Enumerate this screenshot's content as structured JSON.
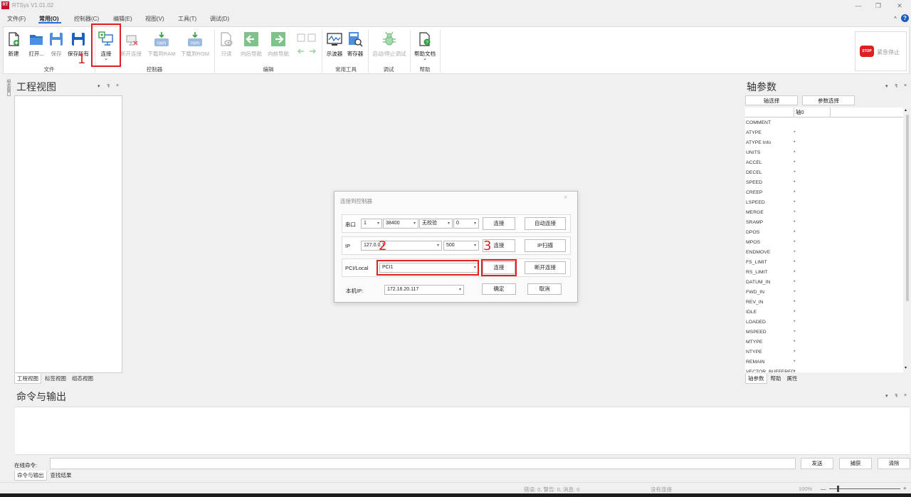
{
  "window": {
    "title": "RTSys V1.01.02",
    "logo": "RT",
    "minimize": "—",
    "restore": "❐",
    "close": "✕"
  },
  "menu": [
    "文件(F)",
    "常用(O)",
    "控制器(C)",
    "编辑(E)",
    "视图(V)",
    "工具(T)",
    "调试(D)"
  ],
  "menu_active_index": 1,
  "menu_collapse": "^",
  "menu_help": "?",
  "ribbon": {
    "buttons": [
      {
        "label": "新建",
        "icon": "new-file-icon"
      },
      {
        "label": "打开...",
        "icon": "open-folder-icon"
      },
      {
        "label": "保存",
        "icon": "save-icon"
      },
      {
        "label": "保存所有",
        "icon": "save-all-icon"
      },
      {
        "label": "连接",
        "icon": "connect-icon"
      },
      {
        "label": "断开连接",
        "icon": "disconnect-icon"
      },
      {
        "label": "下载到RAM",
        "icon": "download-ram-icon",
        "icon_text": "ram"
      },
      {
        "label": "下载到ROM",
        "icon": "download-rom-icon",
        "icon_text": "rom"
      },
      {
        "label": "只读",
        "icon": "read-only-icon"
      },
      {
        "label": "向后导航",
        "icon": "navigate-back-icon"
      },
      {
        "label": "向前导航",
        "icon": "navigate-forward-icon"
      },
      {
        "label": "示波器",
        "icon": "oscilloscope-icon"
      },
      {
        "label": "寄存器",
        "icon": "register-icon"
      },
      {
        "label": "启动/停止调试",
        "icon": "debug-bug-icon"
      },
      {
        "label": "帮助文档",
        "icon": "help-document-icon"
      }
    ],
    "groups": [
      "文件",
      "控制器",
      "编辑",
      "常用工具",
      "调试",
      "帮助"
    ],
    "connect_dropdown": "⌄",
    "help_dropdown": "⌄",
    "estop_icon_text": "STOP",
    "estop_label": "紧急停止"
  },
  "annotations": {
    "step1": "1",
    "step2": "2",
    "step3": "3"
  },
  "left_strip": "组态窗口",
  "project_panel": {
    "title": "工程视图",
    "tabs": [
      "工程视图",
      "标签视图",
      "组态视图"
    ]
  },
  "panel_controls": {
    "dropdown": "▾",
    "pin": "ꟻ",
    "close": "×"
  },
  "axis_panel": {
    "title": "轴参数",
    "axis_select": "轴选择",
    "param_select": "参数选择",
    "column": "轴0",
    "rows": [
      {
        "name": "COMMENT",
        "value": ""
      },
      {
        "name": "ATYPE",
        "value": "*"
      },
      {
        "name": "ATYPE Info",
        "value": "*"
      },
      {
        "name": "UNITS",
        "value": "*"
      },
      {
        "name": "ACCEL",
        "value": "*"
      },
      {
        "name": "DECEL",
        "value": "*"
      },
      {
        "name": "SPEED",
        "value": "*"
      },
      {
        "name": "CREEP",
        "value": "*"
      },
      {
        "name": "LSPEED",
        "value": "*"
      },
      {
        "name": "MERGE",
        "value": "*"
      },
      {
        "name": "SRAMP",
        "value": "*"
      },
      {
        "name": "DPOS",
        "value": "*"
      },
      {
        "name": "MPOS",
        "value": "*"
      },
      {
        "name": "ENDMOVE",
        "value": "*"
      },
      {
        "name": "FS_LIMIT",
        "value": "*"
      },
      {
        "name": "RS_LIMIT",
        "value": "*"
      },
      {
        "name": "DATUM_IN",
        "value": "*"
      },
      {
        "name": "FWD_IN",
        "value": "*"
      },
      {
        "name": "REV_IN",
        "value": "*"
      },
      {
        "name": "IDLE",
        "value": "*"
      },
      {
        "name": "LOADED",
        "value": "*"
      },
      {
        "name": "MSPEED",
        "value": "*"
      },
      {
        "name": "MTYPE",
        "value": "*"
      },
      {
        "name": "NTYPE",
        "value": "*"
      },
      {
        "name": "REMAIN",
        "value": "*"
      },
      {
        "name": "VECTOR_BUFFERED",
        "value": "*"
      }
    ],
    "tabs": [
      "轴参数",
      "帮助",
      "属性"
    ],
    "scroll_up": "▴",
    "scroll_down": "▾"
  },
  "dialog": {
    "title": "连接到控制器",
    "close": "×",
    "serial": {
      "label": "串口",
      "port": "1",
      "baud": "38400",
      "parity": "无校验",
      "extra": "0",
      "connect": "连接",
      "auto_connect": "自动连接"
    },
    "ip": {
      "label": "IP",
      "address": "127.0.0.1",
      "timeout": "500",
      "connect": "连接",
      "scan": "IP扫描"
    },
    "pci": {
      "label": "PCI/Local",
      "value": "PCI1",
      "connect": "连接",
      "disconnect": "断开连接"
    },
    "local_ip": {
      "label": "本机IP:",
      "value": "172.16.20.117",
      "ok": "确定",
      "cancel": "取消"
    },
    "arrow": "▾"
  },
  "command_panel": {
    "title": "命令与输出",
    "input_label": "在线命令:",
    "send": "发送",
    "capture": "捕获",
    "clear": "清除",
    "tabs": [
      "命令与输出",
      "查找结果"
    ]
  },
  "status": {
    "counts": "错误: 0, 警告: 0, 消息: 0",
    "connection": "没有连接",
    "zoom": "100%",
    "zoom_minus": "—",
    "zoom_plus": "+"
  }
}
